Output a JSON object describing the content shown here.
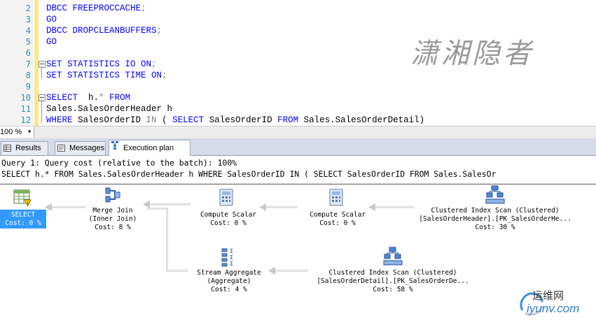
{
  "editor": {
    "lines": [
      {
        "n": "2",
        "parts": [
          {
            "c": "kw",
            "t": "DBCC FREEPROCCACHE"
          },
          {
            "c": "op",
            "t": ";"
          }
        ]
      },
      {
        "n": "3",
        "parts": [
          {
            "c": "kw",
            "t": "GO"
          }
        ]
      },
      {
        "n": "4",
        "parts": [
          {
            "c": "kw",
            "t": "DBCC DROPCLEANBUFFERS"
          },
          {
            "c": "op",
            "t": ";"
          }
        ]
      },
      {
        "n": "5",
        "parts": [
          {
            "c": "kw",
            "t": "GO"
          }
        ]
      },
      {
        "n": "6",
        "parts": []
      },
      {
        "n": "7",
        "parts": [
          {
            "c": "kw",
            "t": "SET STATISTICS IO ON"
          },
          {
            "c": "op",
            "t": ";"
          }
        ]
      },
      {
        "n": "8",
        "parts": [
          {
            "c": "kw",
            "t": "SET STATISTICS TIME ON"
          },
          {
            "c": "op",
            "t": ";"
          }
        ]
      },
      {
        "n": "9",
        "parts": []
      },
      {
        "n": "10",
        "parts": [
          {
            "c": "kw",
            "t": "SELECT"
          },
          {
            "c": "tx",
            "t": "  h."
          },
          {
            "c": "op",
            "t": "*"
          },
          {
            "c": "tx",
            "t": " "
          },
          {
            "c": "kw",
            "t": "FROM"
          }
        ]
      },
      {
        "n": "11",
        "parts": [
          {
            "c": "tx",
            "t": "Sales.SalesOrderHeader h"
          }
        ]
      },
      {
        "n": "12",
        "parts": [
          {
            "c": "kw",
            "t": "WHERE"
          },
          {
            "c": "tx",
            "t": " SalesOrderID "
          },
          {
            "c": "op",
            "t": "IN"
          },
          {
            "c": "tx",
            "t": " ( "
          },
          {
            "c": "kw",
            "t": "SELECT"
          },
          {
            "c": "tx",
            "t": " SalesOrderID "
          },
          {
            "c": "kw",
            "t": "FROM"
          },
          {
            "c": "tx",
            "t": " Sales.SalesOrderDetail)"
          }
        ]
      }
    ],
    "watermark": "潇湘隐者"
  },
  "zoom": {
    "value": "100 %"
  },
  "tabs": [
    {
      "label": "Results",
      "icon": "grid-icon"
    },
    {
      "label": "Messages",
      "icon": "messages-icon"
    },
    {
      "label": "Execution plan",
      "icon": "execution-plan-icon"
    }
  ],
  "plan": {
    "query_header": "Query 1: Query cost (relative to the batch): 100%",
    "query_text": "SELECT h.* FROM Sales.SalesOrderHeader h WHERE SalesOrderID IN ( SELECT SalesOrderID FROM Sales.SalesOr",
    "nodes": {
      "select": {
        "lines": [
          "SELECT",
          "Cost: 0 %"
        ]
      },
      "merge_join": {
        "lines": [
          "Merge Join",
          "(Inner Join)",
          "Cost: 8 %"
        ]
      },
      "compute_scalar_1": {
        "lines": [
          "Compute Scalar",
          "Cost: 0 %"
        ]
      },
      "compute_scalar_2": {
        "lines": [
          "Compute Scalar",
          "Cost: 0 %"
        ]
      },
      "clustered_scan_header": {
        "lines": [
          "Clustered Index Scan (Clustered)",
          "[SalesOrderHeader].[PK_SalesOrderHe...",
          "Cost: 30 %"
        ]
      },
      "stream_aggregate": {
        "lines": [
          "Stream Aggregate",
          "(Aggregate)",
          "Cost: 4 %"
        ]
      },
      "clustered_scan_detail": {
        "lines": [
          "Clustered Index Scan (Clustered)",
          "[SalesOrderDetail].[PK_SalesOrderDe...",
          "Cost: 58 %"
        ]
      }
    }
  },
  "site_logo": {
    "name": "运维网",
    "url": "iyunv.com"
  }
}
